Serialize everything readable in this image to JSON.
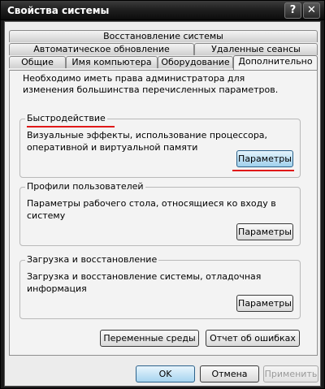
{
  "window": {
    "title": "Свойства системы",
    "help_glyph": "?",
    "close_glyph": "✕"
  },
  "tabs": {
    "row1": [
      "Восстановление системы"
    ],
    "row2": [
      "Автоматическое обновление",
      "Удаленные сеансы"
    ],
    "row3": [
      "Общие",
      "Имя компьютера",
      "Оборудование",
      "Дополнительно"
    ],
    "active": "Дополнительно"
  },
  "panel": {
    "intro": "Необходимо иметь права администратора для изменения большинства перечисленных параметров.",
    "performance": {
      "label": "Быстродействие",
      "description": "Визуальные эффекты, использование процессора, оперативной и виртуальной памяти",
      "button": "Параметры"
    },
    "profiles": {
      "label": "Профили пользователей",
      "description": "Параметры рабочего стола, относящиеся ко входу в систему",
      "button": "Параметры"
    },
    "startup": {
      "label": "Загрузка и восстановление",
      "description": "Загрузка и восстановление системы, отладочная информация",
      "button": "Параметры"
    },
    "env_button": "Переменные среды",
    "errors_button": "Отчет об ошибках"
  },
  "footer": {
    "ok": "OK",
    "cancel": "Отмена",
    "apply": "Применить"
  },
  "colors": {
    "annotation_underline": "#e01818",
    "focus_button": "#9fd0ec"
  }
}
